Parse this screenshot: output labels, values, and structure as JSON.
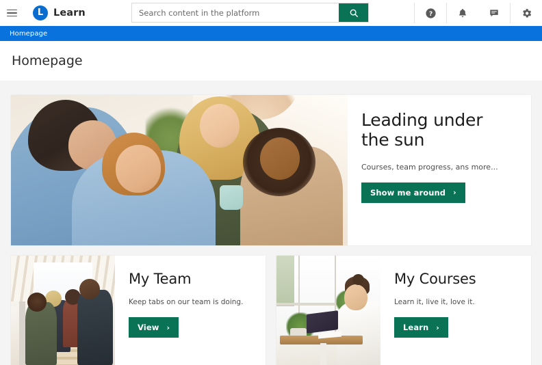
{
  "header": {
    "menu_icon": "hamburger-menu-icon",
    "brand": {
      "logo_letter": "L",
      "name": "Learn"
    },
    "search": {
      "placeholder": "Search content in the platform",
      "value": "",
      "button_icon": "search-icon",
      "button_color": "#0a7355"
    },
    "actions": [
      {
        "icon": "help-icon",
        "name": "help-button"
      },
      {
        "icon": "bell-icon",
        "name": "notifications-button"
      },
      {
        "icon": "message-icon",
        "name": "messages-button"
      },
      {
        "icon": "gear-icon",
        "name": "settings-button"
      }
    ]
  },
  "breadcrumb": {
    "items": [
      "Homepage"
    ],
    "bar_color": "#0a72dc"
  },
  "page": {
    "title": "Homepage",
    "background": "#f4f4f4"
  },
  "hero": {
    "title": "Leading under the sun",
    "subtitle": "Courses, team progress, ans more...",
    "cta_label": "Show me around",
    "cta_chevron": "›",
    "cta_color": "#0a7355",
    "image_alt": "smiling-team-around-laptop-photo"
  },
  "cards": [
    {
      "title": "My Team",
      "subtitle": "Keep tabs on our team is doing.",
      "cta_label": "View",
      "cta_chevron": "›",
      "cta_color": "#0a7355",
      "image_alt": "colleagues-on-office-staircase-photo"
    },
    {
      "title": "My Courses",
      "subtitle": "Learn it, live it, love it.",
      "cta_label": "Learn",
      "cta_chevron": "›",
      "cta_color": "#0a7355",
      "image_alt": "woman-studying-at-desk-with-laptop-photo"
    }
  ]
}
